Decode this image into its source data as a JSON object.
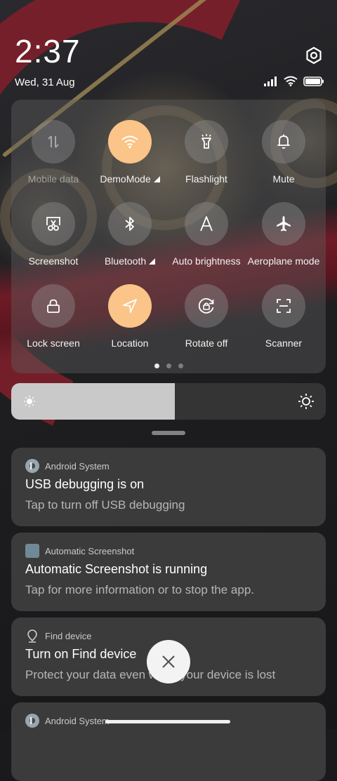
{
  "status": {
    "time": "2:37",
    "date": "Wed, 31 Aug"
  },
  "quick_settings": {
    "tiles": [
      {
        "label": "Mobile data",
        "icon": "mobile-data-icon",
        "active": false,
        "disabled": true
      },
      {
        "label": "DemoMode",
        "icon": "wifi-icon",
        "active": true,
        "has_more": true
      },
      {
        "label": "Flashlight",
        "icon": "flashlight-icon",
        "active": false
      },
      {
        "label": "Mute",
        "icon": "bell-icon",
        "active": false
      },
      {
        "label": "Screenshot",
        "icon": "screenshot-icon",
        "active": false
      },
      {
        "label": "Bluetooth",
        "icon": "bluetooth-icon",
        "active": false,
        "has_more": true
      },
      {
        "label": "Auto brightness",
        "icon": "auto-brightness-icon",
        "active": false
      },
      {
        "label": "Aeroplane mode",
        "icon": "airplane-icon",
        "active": false
      },
      {
        "label": "Lock screen",
        "icon": "lock-icon",
        "active": false
      },
      {
        "label": "Location",
        "icon": "location-icon",
        "active": true
      },
      {
        "label": "Rotate off",
        "icon": "rotate-lock-icon",
        "active": false
      },
      {
        "label": "Scanner",
        "icon": "scanner-icon",
        "active": false
      }
    ],
    "page_count": 3,
    "active_page": 1
  },
  "brightness": {
    "level": 0.52
  },
  "notifications": [
    {
      "app": "Android System",
      "title": "USB debugging is on",
      "body": "Tap to turn off USB debugging"
    },
    {
      "app": "Automatic Screenshot",
      "title": "Automatic Screenshot is running",
      "body": "Tap for more information or to stop the app."
    },
    {
      "app": "Find device",
      "title": "Turn on Find device",
      "body": "Protect your data even when your device is lost"
    },
    {
      "app": "Android System",
      "title": "",
      "body": ""
    }
  ],
  "colors": {
    "accent": "#fbc488",
    "panel": "#5f5f5f",
    "notification": "#3e3e3e"
  }
}
